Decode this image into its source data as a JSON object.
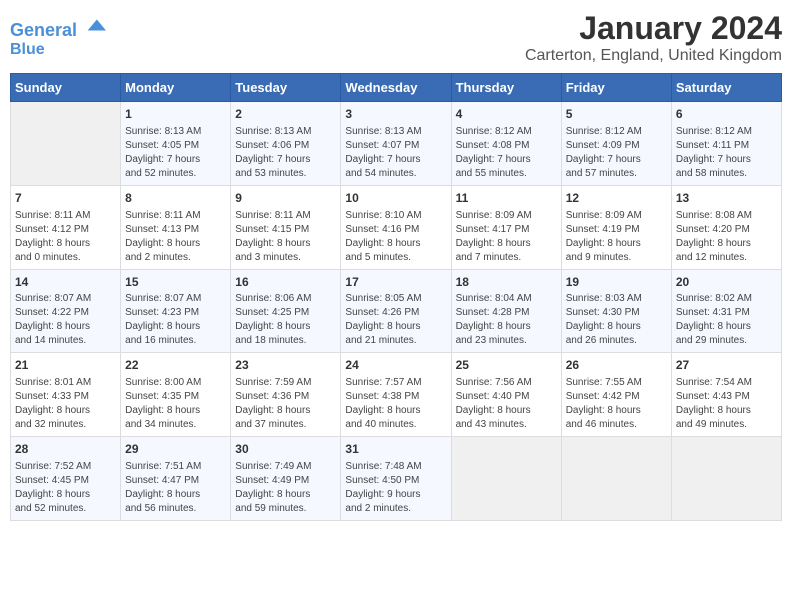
{
  "logo": {
    "line1": "General",
    "line2": "Blue"
  },
  "title": "January 2024",
  "subtitle": "Carterton, England, United Kingdom",
  "days_of_week": [
    "Sunday",
    "Monday",
    "Tuesday",
    "Wednesday",
    "Thursday",
    "Friday",
    "Saturday"
  ],
  "weeks": [
    [
      {
        "day": "",
        "content": ""
      },
      {
        "day": "1",
        "content": "Sunrise: 8:13 AM\nSunset: 4:05 PM\nDaylight: 7 hours\nand 52 minutes."
      },
      {
        "day": "2",
        "content": "Sunrise: 8:13 AM\nSunset: 4:06 PM\nDaylight: 7 hours\nand 53 minutes."
      },
      {
        "day": "3",
        "content": "Sunrise: 8:13 AM\nSunset: 4:07 PM\nDaylight: 7 hours\nand 54 minutes."
      },
      {
        "day": "4",
        "content": "Sunrise: 8:12 AM\nSunset: 4:08 PM\nDaylight: 7 hours\nand 55 minutes."
      },
      {
        "day": "5",
        "content": "Sunrise: 8:12 AM\nSunset: 4:09 PM\nDaylight: 7 hours\nand 57 minutes."
      },
      {
        "day": "6",
        "content": "Sunrise: 8:12 AM\nSunset: 4:11 PM\nDaylight: 7 hours\nand 58 minutes."
      }
    ],
    [
      {
        "day": "7",
        "content": "Sunrise: 8:11 AM\nSunset: 4:12 PM\nDaylight: 8 hours\nand 0 minutes."
      },
      {
        "day": "8",
        "content": "Sunrise: 8:11 AM\nSunset: 4:13 PM\nDaylight: 8 hours\nand 2 minutes."
      },
      {
        "day": "9",
        "content": "Sunrise: 8:11 AM\nSunset: 4:15 PM\nDaylight: 8 hours\nand 3 minutes."
      },
      {
        "day": "10",
        "content": "Sunrise: 8:10 AM\nSunset: 4:16 PM\nDaylight: 8 hours\nand 5 minutes."
      },
      {
        "day": "11",
        "content": "Sunrise: 8:09 AM\nSunset: 4:17 PM\nDaylight: 8 hours\nand 7 minutes."
      },
      {
        "day": "12",
        "content": "Sunrise: 8:09 AM\nSunset: 4:19 PM\nDaylight: 8 hours\nand 9 minutes."
      },
      {
        "day": "13",
        "content": "Sunrise: 8:08 AM\nSunset: 4:20 PM\nDaylight: 8 hours\nand 12 minutes."
      }
    ],
    [
      {
        "day": "14",
        "content": "Sunrise: 8:07 AM\nSunset: 4:22 PM\nDaylight: 8 hours\nand 14 minutes."
      },
      {
        "day": "15",
        "content": "Sunrise: 8:07 AM\nSunset: 4:23 PM\nDaylight: 8 hours\nand 16 minutes."
      },
      {
        "day": "16",
        "content": "Sunrise: 8:06 AM\nSunset: 4:25 PM\nDaylight: 8 hours\nand 18 minutes."
      },
      {
        "day": "17",
        "content": "Sunrise: 8:05 AM\nSunset: 4:26 PM\nDaylight: 8 hours\nand 21 minutes."
      },
      {
        "day": "18",
        "content": "Sunrise: 8:04 AM\nSunset: 4:28 PM\nDaylight: 8 hours\nand 23 minutes."
      },
      {
        "day": "19",
        "content": "Sunrise: 8:03 AM\nSunset: 4:30 PM\nDaylight: 8 hours\nand 26 minutes."
      },
      {
        "day": "20",
        "content": "Sunrise: 8:02 AM\nSunset: 4:31 PM\nDaylight: 8 hours\nand 29 minutes."
      }
    ],
    [
      {
        "day": "21",
        "content": "Sunrise: 8:01 AM\nSunset: 4:33 PM\nDaylight: 8 hours\nand 32 minutes."
      },
      {
        "day": "22",
        "content": "Sunrise: 8:00 AM\nSunset: 4:35 PM\nDaylight: 8 hours\nand 34 minutes."
      },
      {
        "day": "23",
        "content": "Sunrise: 7:59 AM\nSunset: 4:36 PM\nDaylight: 8 hours\nand 37 minutes."
      },
      {
        "day": "24",
        "content": "Sunrise: 7:57 AM\nSunset: 4:38 PM\nDaylight: 8 hours\nand 40 minutes."
      },
      {
        "day": "25",
        "content": "Sunrise: 7:56 AM\nSunset: 4:40 PM\nDaylight: 8 hours\nand 43 minutes."
      },
      {
        "day": "26",
        "content": "Sunrise: 7:55 AM\nSunset: 4:42 PM\nDaylight: 8 hours\nand 46 minutes."
      },
      {
        "day": "27",
        "content": "Sunrise: 7:54 AM\nSunset: 4:43 PM\nDaylight: 8 hours\nand 49 minutes."
      }
    ],
    [
      {
        "day": "28",
        "content": "Sunrise: 7:52 AM\nSunset: 4:45 PM\nDaylight: 8 hours\nand 52 minutes."
      },
      {
        "day": "29",
        "content": "Sunrise: 7:51 AM\nSunset: 4:47 PM\nDaylight: 8 hours\nand 56 minutes."
      },
      {
        "day": "30",
        "content": "Sunrise: 7:49 AM\nSunset: 4:49 PM\nDaylight: 8 hours\nand 59 minutes."
      },
      {
        "day": "31",
        "content": "Sunrise: 7:48 AM\nSunset: 4:50 PM\nDaylight: 9 hours\nand 2 minutes."
      },
      {
        "day": "",
        "content": ""
      },
      {
        "day": "",
        "content": ""
      },
      {
        "day": "",
        "content": ""
      }
    ]
  ]
}
